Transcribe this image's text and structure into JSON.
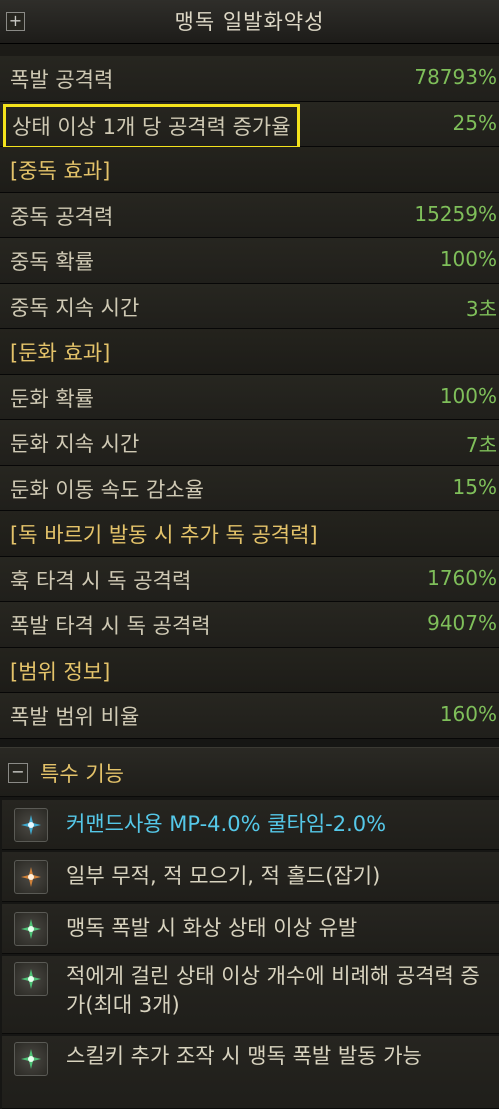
{
  "header": {
    "title": "맹독 일발화약성",
    "expand_symbol": "+"
  },
  "stats": [
    {
      "label": "폭발 공격력",
      "value": "78793%",
      "type": "stat"
    },
    {
      "label": "상태 이상 1개 당 공격력 증가율",
      "value": "25%",
      "type": "stat",
      "highlight": true
    },
    {
      "label": "[중독 효과]",
      "value": "",
      "type": "section"
    },
    {
      "label": "중독 공격력",
      "value": "15259%",
      "type": "stat"
    },
    {
      "label": "중독 확률",
      "value": "100%",
      "type": "stat"
    },
    {
      "label": "중독 지속 시간",
      "value": "3초",
      "type": "stat"
    },
    {
      "label": "[둔화 효과]",
      "value": "",
      "type": "section"
    },
    {
      "label": "둔화 확률",
      "value": "100%",
      "type": "stat"
    },
    {
      "label": "둔화 지속 시간",
      "value": "7초",
      "type": "stat"
    },
    {
      "label": "둔화 이동 속도 감소율",
      "value": "15%",
      "type": "stat"
    },
    {
      "label": "[독 바르기 발동 시 추가 독 공격력]",
      "value": "",
      "type": "section"
    },
    {
      "label": "훅 타격 시 독 공격력",
      "value": "1760%",
      "type": "stat"
    },
    {
      "label": "폭발 타격 시 독 공격력",
      "value": "9407%",
      "type": "stat"
    },
    {
      "label": "[범위 정보]",
      "value": "",
      "type": "section"
    },
    {
      "label": "폭발 범위 비율",
      "value": "160%",
      "type": "stat"
    }
  ],
  "special": {
    "title": "특수 기능",
    "collapse_symbol": "−",
    "items": [
      {
        "text": "커맨드사용 MP-4.0% 쿨타임-2.0%",
        "icon": "cyan-swirl-icon",
        "color": "#55c8e8"
      },
      {
        "text": "일부 무적, 적 모으기, 적 홀드(잡기)",
        "icon": "orange-swirl-icon",
        "color": "#d8d3bf"
      },
      {
        "text": "맹독 폭발 시 화상 상태 이상 유발",
        "icon": "green-swirl-icon",
        "color": "#d8d3bf"
      },
      {
        "text": "적에게 걸린 상태 이상 개수에 비례해 공격력 증가(최대 3개)",
        "icon": "green-swirl-icon",
        "color": "#d8d3bf"
      },
      {
        "text": "스킬키 추가 조작 시 맹독 폭발 발동 가능",
        "icon": "green-swirl-icon",
        "color": "#d8d3bf"
      }
    ]
  },
  "colors": {
    "section_label": "#e4c36a",
    "stat_value": "#7fbf5a",
    "highlight_border": "#f4e31c",
    "icon_cyan": "#3fb6e0",
    "icon_orange": "#e08a3a",
    "icon_green": "#4fd07c"
  }
}
